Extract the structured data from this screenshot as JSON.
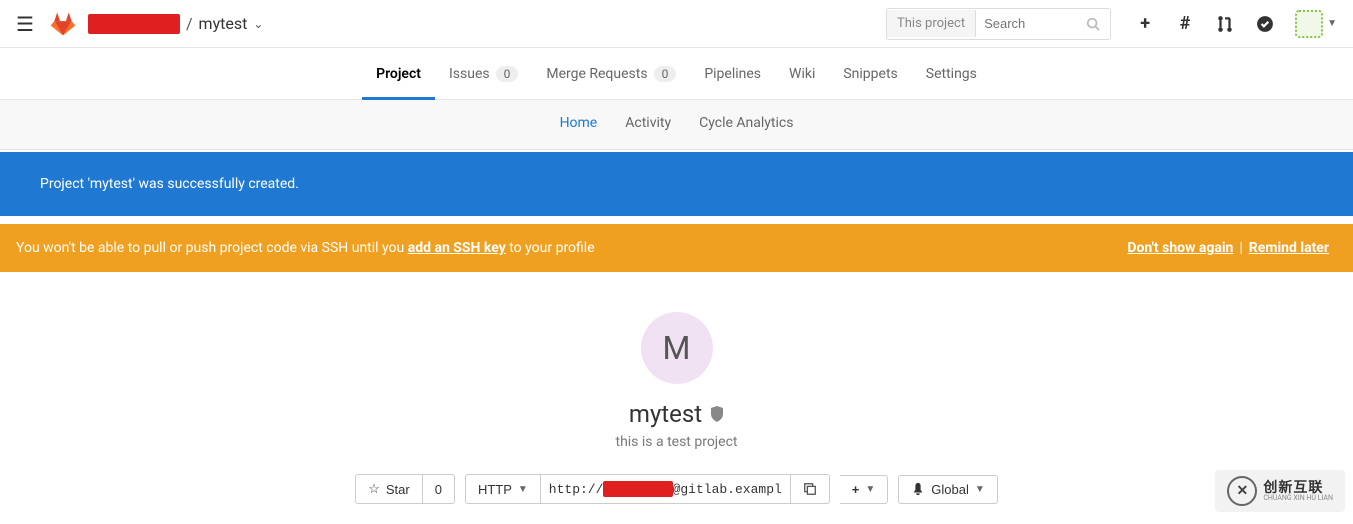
{
  "header": {
    "breadcrumb_sep": "/",
    "project_name": "mytest",
    "search_scope": "This project",
    "search_placeholder": "Search"
  },
  "primary_tabs": [
    {
      "label": "Project",
      "badge": null,
      "active": true
    },
    {
      "label": "Issues",
      "badge": "0",
      "active": false
    },
    {
      "label": "Merge Requests",
      "badge": "0",
      "active": false
    },
    {
      "label": "Pipelines",
      "badge": null,
      "active": false
    },
    {
      "label": "Wiki",
      "badge": null,
      "active": false
    },
    {
      "label": "Snippets",
      "badge": null,
      "active": false
    },
    {
      "label": "Settings",
      "badge": null,
      "active": false
    }
  ],
  "secondary_tabs": [
    {
      "label": "Home",
      "active": true
    },
    {
      "label": "Activity",
      "active": false
    },
    {
      "label": "Cycle Analytics",
      "active": false
    }
  ],
  "alerts": {
    "success": "Project 'mytest' was successfully created.",
    "warning_prefix": "You won't be able to pull or push project code via SSH until you ",
    "warning_link": "add an SSH key",
    "warning_suffix": " to your profile",
    "dont_show": "Don't show again",
    "remind_later": "Remind later",
    "sep": "|"
  },
  "project": {
    "avatar_letter": "M",
    "name": "mytest",
    "description": "this is a test project"
  },
  "actionbar": {
    "star": "Star",
    "star_count": "0",
    "protocol": "HTTP",
    "url_prefix": "http://",
    "url_suffix": "@gitlab.exampl",
    "global": "Global"
  },
  "watermark": {
    "main": "创新互联",
    "sub": "CHUANG XIN HU LIAN"
  }
}
